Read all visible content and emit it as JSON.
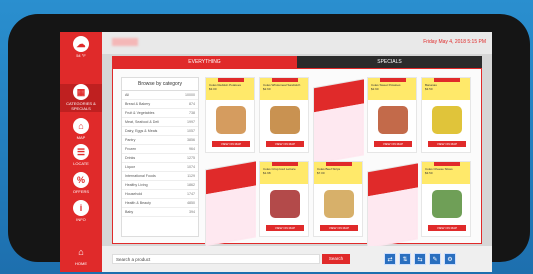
{
  "status": {
    "temperature": "54 °F",
    "datetime": "Friday May 4, 2018    5:15 PM"
  },
  "rail": {
    "items": [
      {
        "label": "CATEGORIES\n& SPECIALS"
      },
      {
        "label": "MAP"
      },
      {
        "label": "LOCATE"
      },
      {
        "label": "OFFERS"
      },
      {
        "label": "INFO"
      },
      {
        "label": "HOME"
      }
    ]
  },
  "tabs": {
    "everything": "EVERYTHING",
    "specials": "SPECIALS"
  },
  "categories": {
    "title": "Browse by category",
    "header_left": "All",
    "header_right": "10000",
    "rows": [
      {
        "name": "Bread & Bakery",
        "count": "874"
      },
      {
        "name": "Fruit & Vegetables",
        "count": "738"
      },
      {
        "name": "Meat, Seafood & Deli",
        "count": "1997"
      },
      {
        "name": "Dairy, Eggs & Meals",
        "count": "1057"
      },
      {
        "name": "Pantry",
        "count": "3856"
      },
      {
        "name": "Frozen",
        "count": "964"
      },
      {
        "name": "Drinks",
        "count": "1275"
      },
      {
        "name": "Liquor",
        "count": "1074"
      },
      {
        "name": "International Foods",
        "count": "1129"
      },
      {
        "name": "Healthy Living",
        "count": "1862"
      },
      {
        "name": "Household",
        "count": "1747"
      },
      {
        "name": "Health & Beauty",
        "count": "4850"
      },
      {
        "name": "Baby",
        "count": "394"
      }
    ]
  },
  "cards": [
    {
      "title": "Coles\nRedskin Potatoes",
      "price": "$3.00",
      "button": "VIEW ON MAP",
      "img_color": "#d59c5f"
    },
    {
      "title": "Coles\nWholemeal Sandwich",
      "price": "$2.60",
      "button": "VIEW ON MAP",
      "img_color": "#c99251"
    },
    {
      "title": "Coles\nSweet Potatoes",
      "price": "$2.90",
      "button": "VIEW ON MAP",
      "img_color": "#c36a4a"
    },
    {
      "title": "Bananas",
      "price": "$3.50",
      "button": "VIEW ON MAP",
      "img_color": "#e0c43a"
    },
    {
      "title": "Coles\nCrisp Iced Lettuce",
      "price": "$1.98",
      "button": "VIEW ON MAP",
      "img_color": "#6e9d52"
    },
    {
      "title": "Coles\nBeef Strips",
      "price": "$7.00",
      "button": "VIEW ON MAP",
      "img_color": "#b34a4a"
    },
    {
      "title": "Coles\nRSPCA Approved Chicken",
      "price": "$4.00",
      "button": "VIEW ON MAP",
      "img_color": "#d7b06a"
    },
    {
      "title": "Coles\nCheese Slices",
      "price": "$3.50",
      "button": "VIEW ON MAP",
      "img_color": "#6f9f57"
    }
  ],
  "search": {
    "placeholder": "Search a product",
    "button": "Search"
  },
  "tools": [
    "⇄",
    "⇅",
    "⇆",
    "✎",
    "⚙"
  ]
}
